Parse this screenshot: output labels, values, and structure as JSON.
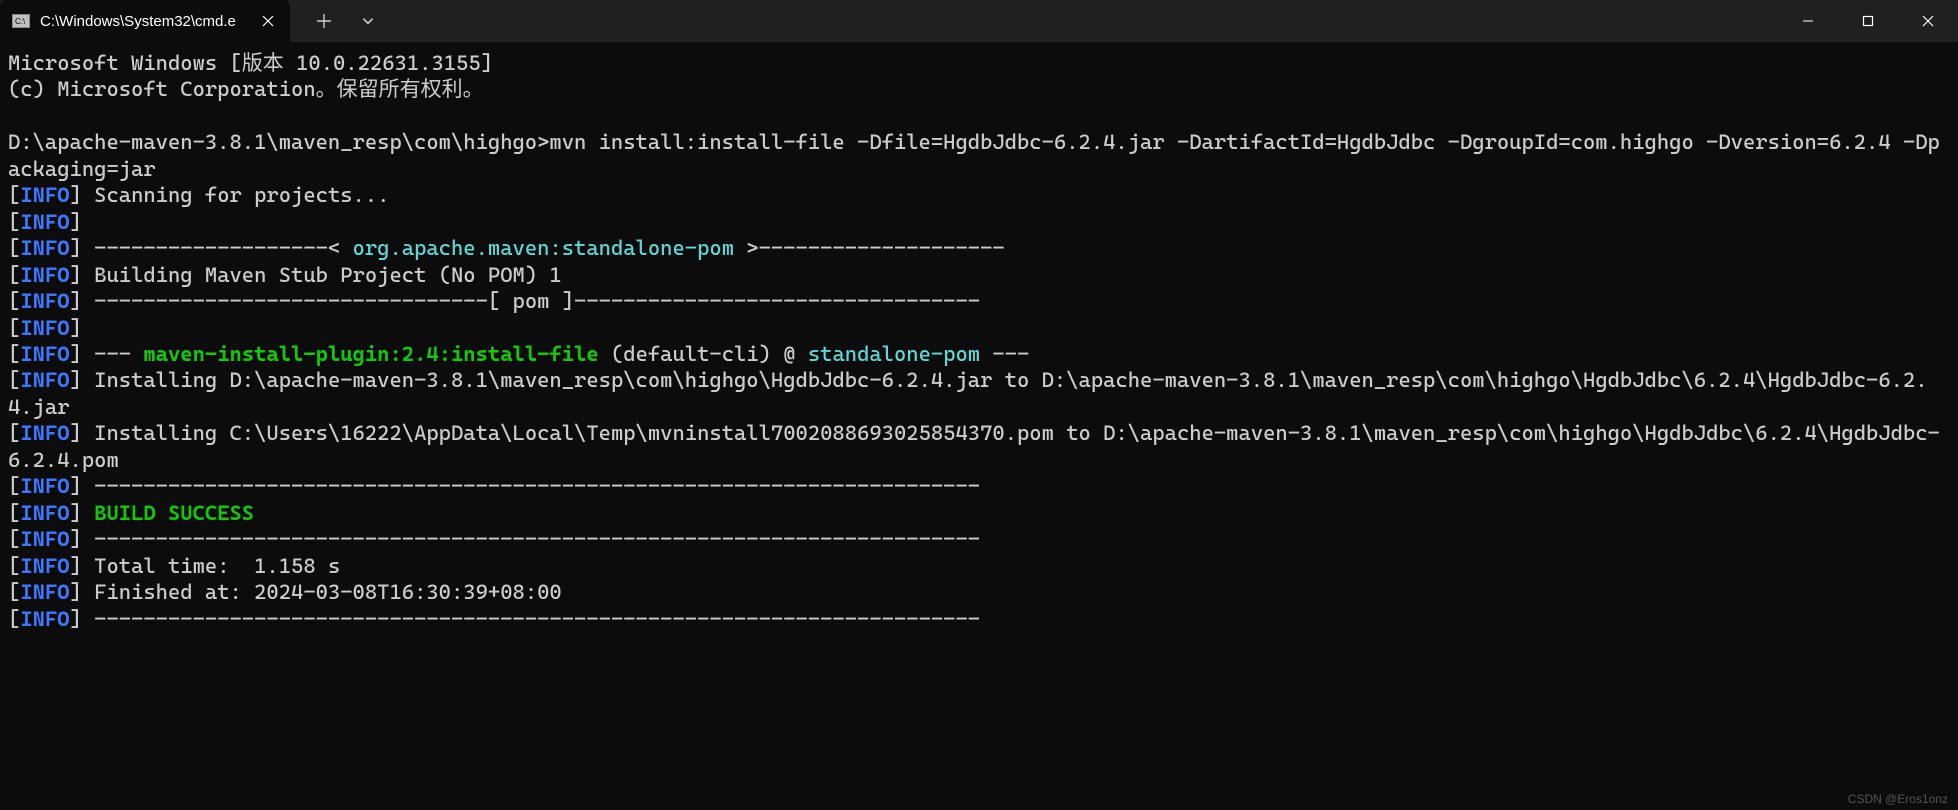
{
  "tab": {
    "title": "C:\\Windows\\System32\\cmd.e"
  },
  "header": {
    "line1": "Microsoft Windows [版本 10.0.22631.3155]",
    "line2": "(c) Microsoft Corporation。保留所有权利。"
  },
  "command": {
    "prompt_and_cmd": "D:\\apache-maven-3.8.1\\maven_resp\\com\\highgo>mvn install:install-file -Dfile=HgdbJdbc-6.2.4.jar -DartifactId=HgdbJdbc -DgroupId=com.highgo -Dversion=6.2.4 -Dpackaging=jar"
  },
  "log": {
    "info_label": "INFO",
    "scanning": " Scanning for projects...",
    "sep_left": " -------------------< ",
    "artifact": "org.apache.maven:standalone-pom",
    "sep_right": " >--------------------",
    "building": " Building Maven Stub Project (No POM) 1",
    "sep_pom": " --------------------------------[ pom ]---------------------------------",
    "plugin_prefix": " --- ",
    "plugin": "maven-install-plugin:2.4:install-file",
    "plugin_cli": " (default-cli) @ ",
    "plugin_target": "standalone-pom",
    "plugin_suffix": " ---",
    "install1": " Installing D:\\apache-maven-3.8.1\\maven_resp\\com\\highgo\\HgdbJdbc-6.2.4.jar to D:\\apache-maven-3.8.1\\maven_resp\\com\\highgo\\HgdbJdbc\\6.2.4\\HgdbJdbc-6.2.4.jar",
    "install2": " Installing C:\\Users\\16222\\AppData\\Local\\Temp\\mvninstall7002088693025854370.pom to D:\\apache-maven-3.8.1\\maven_resp\\com\\highgo\\HgdbJdbc\\6.2.4\\HgdbJdbc-6.2.4.pom",
    "sep_dash": " ------------------------------------------------------------------------",
    "build_success": " BUILD SUCCESS",
    "total_time": " Total time:  1.158 s",
    "finished_at": " Finished at: 2024-03-08T16:30:39+08:00"
  },
  "watermark": "CSDN @Eros1onz"
}
